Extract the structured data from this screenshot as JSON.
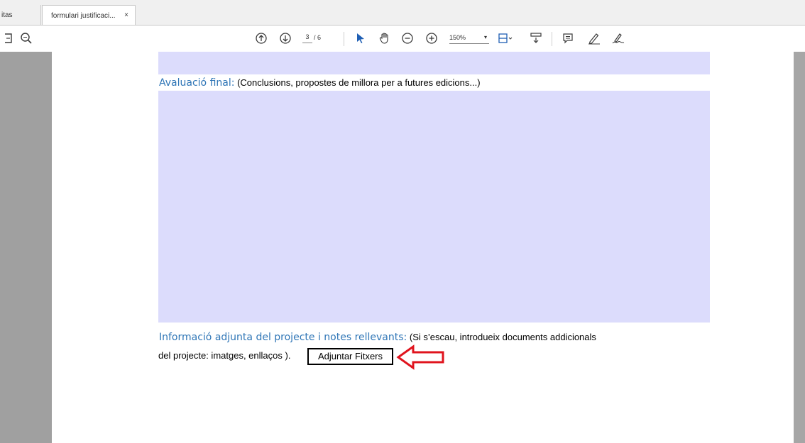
{
  "tabs": [
    {
      "label": "itas",
      "active": false
    },
    {
      "label": "formulari justificaci...",
      "active": true,
      "close": "×"
    }
  ],
  "toolbar": {
    "current_page": "3",
    "total_pages": "/ 6",
    "zoom": "150%",
    "icons": [
      "save-icon",
      "zoom-search-icon",
      "page-up-icon",
      "page-down-icon",
      "select-pointer-icon",
      "hand-tool-icon",
      "zoom-out-icon",
      "zoom-in-icon",
      "fit-page-icon",
      "scroll-mode-icon",
      "comment-icon",
      "highlight-pen-icon",
      "sign-icon"
    ]
  },
  "document": {
    "section1_title": "Avaluació final:",
    "section1_note": " (Conclusions, propostes de millora per a futures edicions...)",
    "section2_title": "Informació adjunta del projecte i notes rellevants:",
    "section2_note": " (Si s’escau, introdueix documents addicionals",
    "section2_line2": "del projecte: imatges, enllaços ).",
    "attach_button": "Adjuntar Fitxers"
  },
  "colors": {
    "field_fill": "#dcdcfc",
    "heading": "#2e75b6",
    "annotation_arrow": "#e0141e"
  }
}
